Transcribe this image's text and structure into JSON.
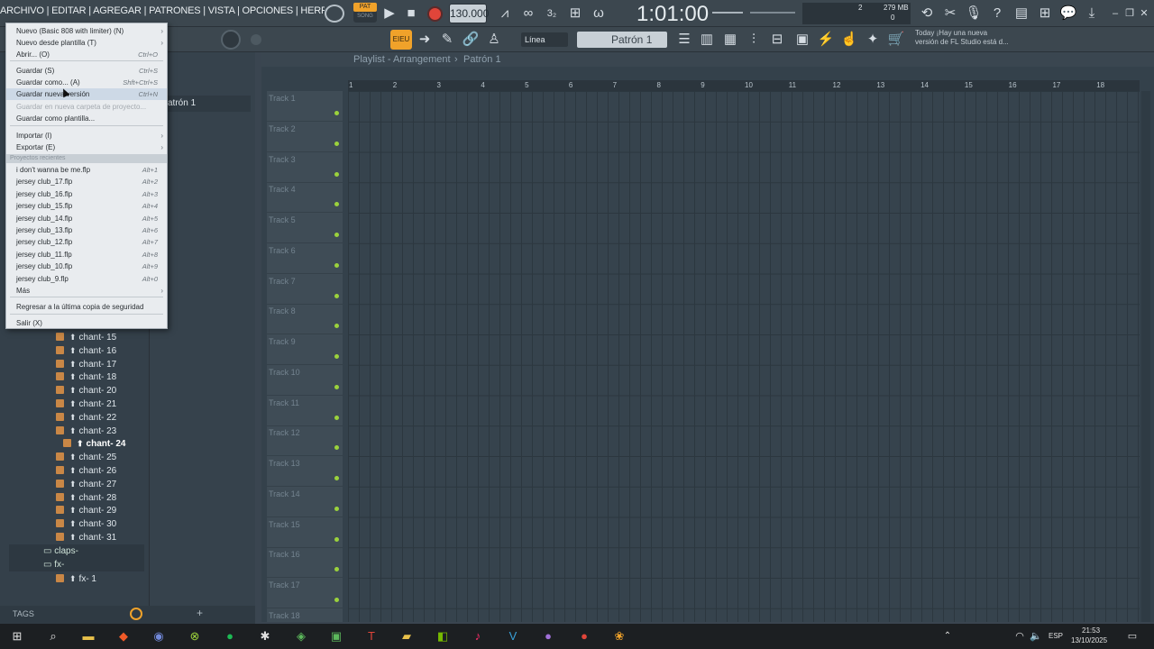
{
  "topbar": {
    "menu_text": "ARCHIVO | EDITAR | AGREGAR | PATRONES | VISTA | OPCIONES | HERRAMIENTAS | AYUD",
    "pat_label": "PAT",
    "song_label": "SONG",
    "tempo": "130.000",
    "time_display": "1:01:00",
    "cpu_mb": "279 MB",
    "cpu_val": "2",
    "poly_val": "0"
  },
  "row2": {
    "snap_label": "Línea",
    "pattern_label": "Patrón 1",
    "news_line1": "Today  ¡Hay una nueva",
    "news_line2": "versión de FL Studio está d..."
  },
  "playlist": {
    "title": "Playlist - Arrangement",
    "title_sep": "›",
    "pattern": "Patrón 1",
    "ruler": [
      "1",
      "2",
      "3",
      "4",
      "5",
      "6",
      "7",
      "8",
      "9",
      "10",
      "11",
      "12",
      "13",
      "14",
      "15",
      "16",
      "17",
      "18"
    ],
    "tracks": [
      "Track 1",
      "Track 2",
      "Track 3",
      "Track 4",
      "Track 5",
      "Track 6",
      "Track 7",
      "Track 8",
      "Track 9",
      "Track 10",
      "Track 11",
      "Track 12",
      "Track 13",
      "Track 14",
      "Track 15",
      "Track 16",
      "Track 17",
      "Track 18"
    ]
  },
  "channel_rack": {
    "pattern_label": "atrón 1"
  },
  "file_menu": {
    "items": [
      {
        "label": "Nuevo (Basic 808 with limiter) (N)",
        "shortcut": "",
        "arrow": true
      },
      {
        "label": "Nuevo desde plantilla (T)",
        "shortcut": "",
        "arrow": true
      },
      {
        "label": "Abrir... (O)",
        "shortcut": "Ctrl+O",
        "arrow": false
      },
      {
        "label": "Guardar (S)",
        "shortcut": "Ctrl+S",
        "arrow": false
      },
      {
        "label": "Guardar como... (A)",
        "shortcut": "Shft+Ctrl+S",
        "arrow": false
      },
      {
        "label": "Guardar nueva versión",
        "shortcut": "Ctrl+N",
        "arrow": false
      },
      {
        "label": "Guardar en nueva carpeta de proyecto...",
        "shortcut": "",
        "arrow": false
      },
      {
        "label": "Guardar como plantilla...",
        "shortcut": "",
        "arrow": false
      },
      {
        "label": "Importar (I)",
        "shortcut": "",
        "arrow": true
      },
      {
        "label": "Exportar (E)",
        "shortcut": "",
        "arrow": true
      }
    ],
    "recent_header": "Proyectos recientes",
    "recent": [
      {
        "label": "i don't wanna be me.flp",
        "shortcut": "Alt+1"
      },
      {
        "label": "jersey club_17.flp",
        "shortcut": "Alt+2"
      },
      {
        "label": "jersey club_16.flp",
        "shortcut": "Alt+3"
      },
      {
        "label": "jersey club_15.flp",
        "shortcut": "Alt+4"
      },
      {
        "label": "jersey club_14.flp",
        "shortcut": "Alt+5"
      },
      {
        "label": "jersey club_13.flp",
        "shortcut": "Alt+6"
      },
      {
        "label": "jersey club_12.flp",
        "shortcut": "Alt+7"
      },
      {
        "label": "jersey club_11.flp",
        "shortcut": "Alt+8"
      },
      {
        "label": "jersey club_10.flp",
        "shortcut": "Alt+9"
      },
      {
        "label": "jersey club_9.flp",
        "shortcut": "Alt+0"
      }
    ],
    "more": "Más",
    "backup": "Regresar a la última copia de seguridad",
    "exit": "Salir (X)"
  },
  "browser": {
    "items": [
      "chant- 15",
      "chant- 16",
      "chant- 17",
      "chant- 18",
      "chant- 20",
      "chant- 21",
      "chant- 22",
      "chant- 23"
    ],
    "selected": "chant- 24",
    "items2": [
      "chant- 25",
      "chant- 26",
      "chant- 27",
      "chant- 28",
      "chant- 29",
      "chant- 30",
      "chant- 31"
    ],
    "folder1": "claps-",
    "folder2": "fx-",
    "sub1": "fx- 1",
    "tags": "TAGS"
  },
  "taskbar": {
    "lang": "ESP",
    "time": "21:53",
    "date": "13/10/2025"
  },
  "colors": {
    "accent_orange": "#f0a22a",
    "record_red": "#e0453a",
    "track_dot_green": "#9bd23c"
  }
}
